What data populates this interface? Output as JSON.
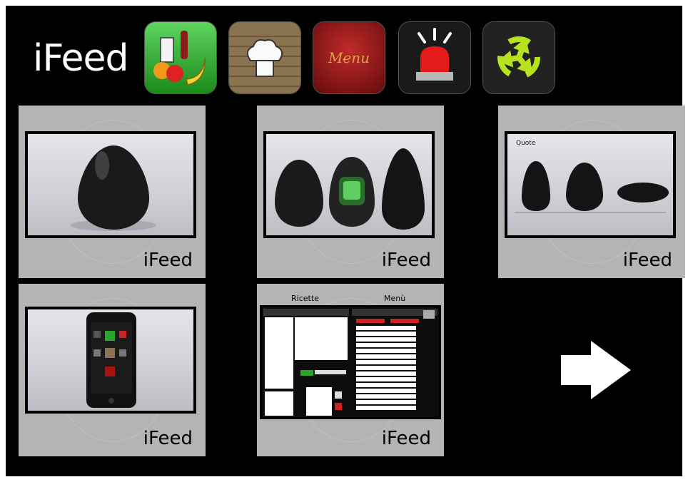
{
  "app_title": "iFeed",
  "toolbar": {
    "icons": [
      {
        "name": "groceries-icon",
        "color": "#2aa52a"
      },
      {
        "name": "chef-hat-icon",
        "color": "#8a7350"
      },
      {
        "name": "menu-card-icon",
        "label": "Menu",
        "color": "#9a1a1a"
      },
      {
        "name": "alarm-siren-icon",
        "color": "#1a1a1a"
      },
      {
        "name": "recycle-icon",
        "color": "#222222"
      }
    ]
  },
  "tiles": [
    {
      "label": "iFeed"
    },
    {
      "label": "iFeed"
    },
    {
      "label": "iFeed",
      "frame_caption": "Quote"
    },
    {
      "label": "iFeed"
    },
    {
      "label": "iFeed",
      "col_left": "Ricette",
      "col_right": "Menù"
    }
  ],
  "next_arrow": {
    "icon": "arrow-right-icon"
  }
}
